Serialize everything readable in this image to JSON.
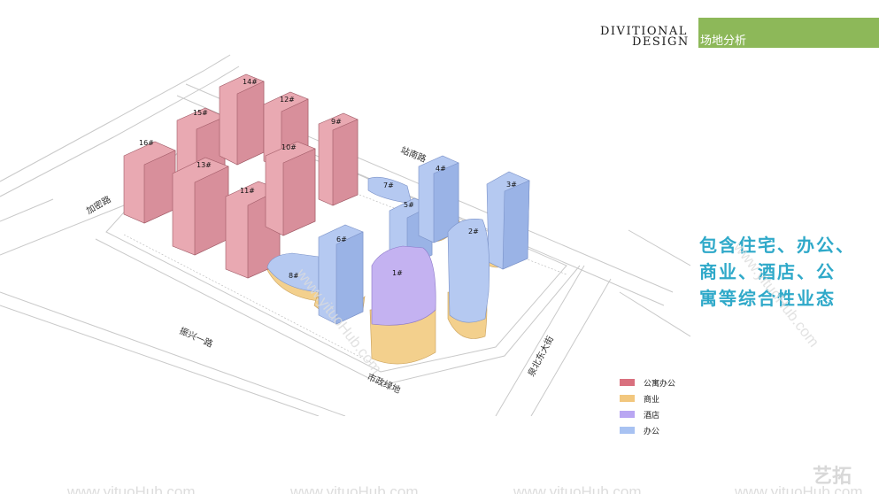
{
  "header": {
    "brand_line1": "DIVITIONAL",
    "brand_line2": "DESIGN",
    "section_title": "场地分析"
  },
  "caption": {
    "lines": [
      "包含住宅、办公、",
      "商业、酒店、公",
      "寓等综合性业态"
    ]
  },
  "roads": {
    "jiaxin": "加密路",
    "zhannan": "站南路",
    "zhenxing": "振兴一路",
    "quanbei": "泉北东大街",
    "shizheng": "市政绿地"
  },
  "buildings": [
    {
      "id": "16#",
      "type": "apartment"
    },
    {
      "id": "15#",
      "type": "apartment"
    },
    {
      "id": "14#",
      "type": "apartment"
    },
    {
      "id": "13#",
      "type": "apartment"
    },
    {
      "id": "12#",
      "type": "apartment"
    },
    {
      "id": "11#",
      "type": "apartment"
    },
    {
      "id": "10#",
      "type": "apartment"
    },
    {
      "id": "9#",
      "type": "apartment"
    },
    {
      "id": "8#",
      "type": "office"
    },
    {
      "id": "7#",
      "type": "office"
    },
    {
      "id": "6#",
      "type": "office"
    },
    {
      "id": "5#",
      "type": "office"
    },
    {
      "id": "4#",
      "type": "office"
    },
    {
      "id": "3#",
      "type": "office"
    },
    {
      "id": "2#",
      "type": "office"
    },
    {
      "id": "1#",
      "type": "hotel"
    }
  ],
  "legend": [
    {
      "label": "公寓办公",
      "color": "#d9707e"
    },
    {
      "label": "商业",
      "color": "#f2c77e"
    },
    {
      "label": "酒店",
      "color": "#b9a6f2"
    },
    {
      "label": "办公",
      "color": "#a8c2f2"
    }
  ],
  "colors": {
    "apartment_fill": "#e9a9b2",
    "apartment_side": "#d88f9b",
    "office_fill": "#b5c9f1",
    "office_side": "#9ab3e6",
    "hotel_fill": "#c4b2f1",
    "podium_fill": "#f3d08d",
    "accent_green": "#8db859",
    "caption_blue": "#2fa9c9"
  },
  "watermarks": {
    "bottom_text": "www.yituoHub.com",
    "diag_text_1": "www.yituoHub.com",
    "diag_text_2": "www.yituoHub.com",
    "corner_logo": "艺拓"
  }
}
